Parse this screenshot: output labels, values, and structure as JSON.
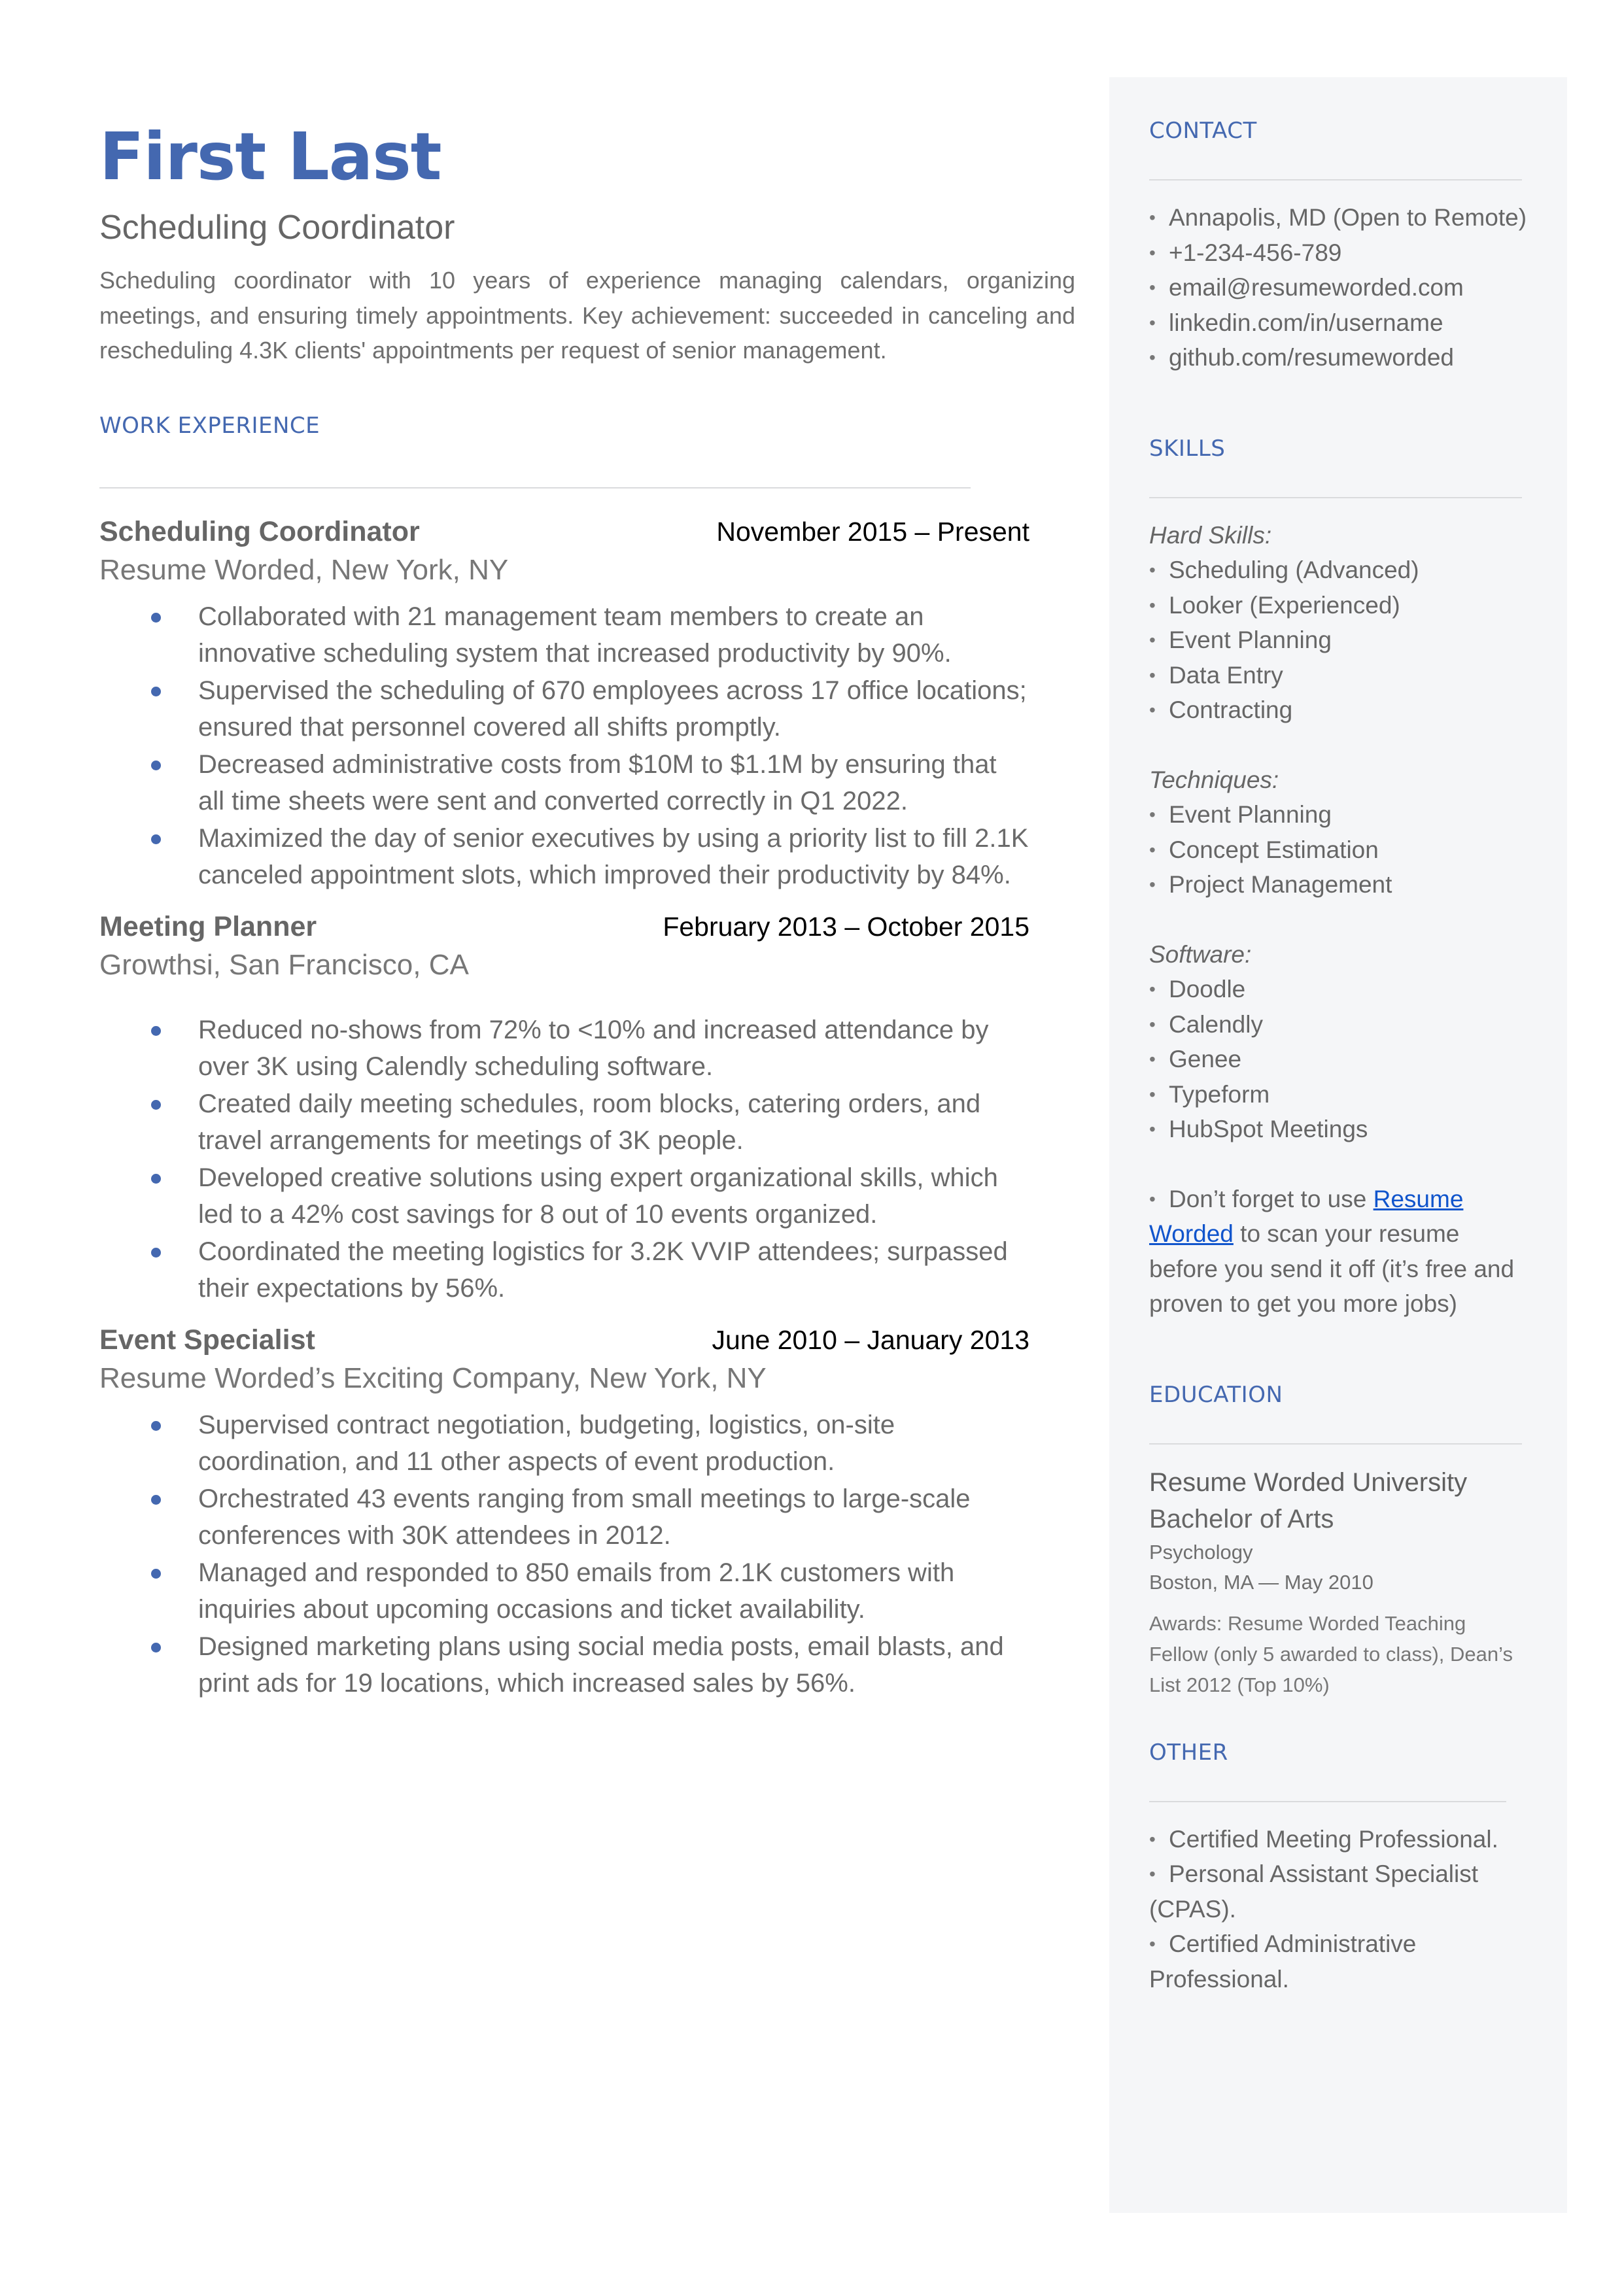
{
  "header": {
    "name": "First Last",
    "title": "Scheduling Coordinator",
    "summary": "Scheduling coordinator with 10 years of experience managing calendars, organizing meetings, and ensuring timely appointments. Key achievement: succeeded in canceling and rescheduling 4.3K clients' appointments per request of senior management."
  },
  "colors": {
    "accent": "#4468B0",
    "link": "#1155CC",
    "sidebar_bg": "#F5F6F8",
    "text": "#666666"
  },
  "work": {
    "heading": "WORK EXPERIENCE",
    "jobs": [
      {
        "title": "Scheduling Coordinator",
        "dates": "November 2015 – Present",
        "company": "Resume Worded, New York, NY",
        "bullets": [
          "Collaborated with 21 management team members to create an innovative scheduling system that increased productivity by 90%.",
          "Supervised the scheduling of 670 employees across 17 office locations; ensured that personnel covered all shifts promptly.",
          "Decreased administrative costs from $10M to $1.1M by ensuring that all time sheets were sent and converted correctly in Q1 2022.",
          "Maximized the day of senior executives by using a priority list to fill 2.1K canceled appointment slots, which improved their productivity by 84%."
        ]
      },
      {
        "title": "Meeting Planner",
        "dates": "February 2013 – October 2015",
        "company": "Growthsi, San Francisco, CA",
        "bullets": [
          "Reduced no-shows from 72% to <10% and increased attendance by over 3K using Calendly scheduling software.",
          "Created daily meeting schedules, room blocks, catering orders, and travel arrangements for meetings of 3K people.",
          "Developed creative solutions using expert organizational skills, which led to a 42% cost savings for 8 out of 10 events organized.",
          "Coordinated the meeting logistics for 3.2K VVIP attendees; surpassed their expectations by 56%."
        ]
      },
      {
        "title": "Event Specialist",
        "dates": "June 2010 – January 2013",
        "company": "Resume Worded’s Exciting Company, New York, NY",
        "bullets": [
          "Supervised contract negotiation, budgeting, logistics, on-site coordination, and 11 other aspects of event production.",
          "Orchestrated 43 events ranging from small meetings to large-scale conferences with 30K attendees in 2012.",
          "Managed and responded to 850 emails from 2.1K customers with inquiries about upcoming occasions and ticket availability.",
          "Designed marketing plans using social media posts, email blasts, and print ads for 19 locations, which increased sales by 56%."
        ]
      }
    ]
  },
  "sidebar": {
    "contact": {
      "heading": "CONTACT",
      "items": [
        "Annapolis, MD (Open to Remote)",
        "+1-234-456-789",
        "email@resumeworded.com",
        "linkedin.com/in/username",
        "github.com/resumeworded"
      ]
    },
    "skills": {
      "heading": "SKILLS",
      "groups": [
        {
          "label": "Hard Skills:",
          "items": [
            "Scheduling (Advanced)",
            "Looker (Experienced)",
            "Event Planning",
            "Data Entry",
            "Contracting"
          ]
        },
        {
          "label": "Techniques:",
          "items": [
            "Event Planning",
            "Concept Estimation",
            "Project Management"
          ]
        },
        {
          "label": "Software:",
          "items": [
            "Doodle",
            "Calendly",
            "Genee",
            "Typeform",
            "HubSpot Meetings"
          ]
        }
      ],
      "tip": {
        "before": "Don’t forget to use ",
        "link_text": "Resume Worded",
        "after": " to scan your resume before you send it off (it’s free and proven to get you more jobs)"
      }
    },
    "education": {
      "heading": "EDUCATION",
      "school": "Resume Worded University",
      "degree": "Bachelor of Arts",
      "field": "Psychology",
      "location_date": "Boston, MA — May 2010",
      "awards": "Awards: Resume Worded Teaching Fellow (only 5 awarded to class), Dean’s List 2012 (Top 10%)"
    },
    "other": {
      "heading": "OTHER",
      "items": [
        "Certified Meeting Professional.",
        "Personal Assistant Specialist (CPAS).",
        "Certified Administrative Professional."
      ]
    }
  }
}
